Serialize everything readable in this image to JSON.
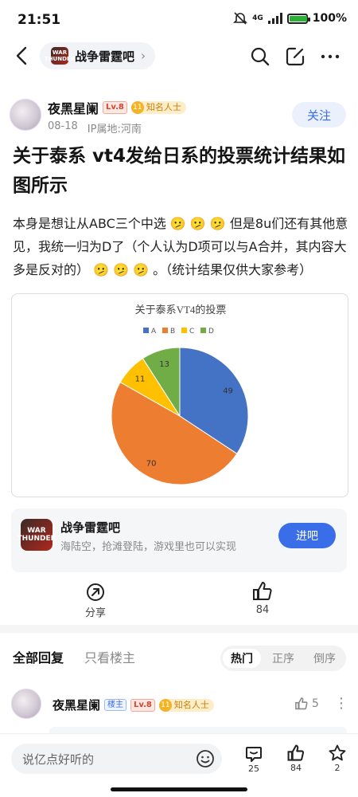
{
  "status": {
    "time": "21:51",
    "network": "4G",
    "battery": "100%",
    "battery_level": 1.0
  },
  "header": {
    "forum_name": "战争雷霆吧",
    "logo_text": "WAR THUNDER"
  },
  "post": {
    "author": "夜黑星阑",
    "level": "Lv.8",
    "badge": "知名人士",
    "badge_num": "11",
    "date": "08-18",
    "ip": "IP属地:河南",
    "follow_label": "关注",
    "title": "关于泰系 vt4发给日系的投票统计结果如图所示",
    "body": "本身是想让从ABC三个中选 🫤 🫤 🫤 但是8u们还有其他意见，我统一归为D了（个人认为D项可以与A合并，其内容大多是反对的） 🫤 🫤 🫤 。（统计结果仅供大家参考）"
  },
  "chart_data": {
    "type": "pie",
    "title": "关于泰系VT4的投票",
    "categories": [
      "A",
      "B",
      "C",
      "D"
    ],
    "values": [
      49,
      70,
      11,
      13
    ],
    "colors": [
      "#4472c4",
      "#ed7d31",
      "#ffc000",
      "#70ad47"
    ],
    "legend": "top"
  },
  "forum_card": {
    "name": "战争雷霆吧",
    "desc": "海陆空，抢滩登陆，游戏里也可以实现",
    "enter_label": "进吧"
  },
  "actions": {
    "share_label": "分享",
    "like_count": "84"
  },
  "replies": {
    "tab_all": "全部回复",
    "tab_op": "只看楼主",
    "sort": [
      "热门",
      "正序",
      "倒序"
    ],
    "first": {
      "author": "夜黑星阑",
      "host_tag": "楼主",
      "level": "Lv.8",
      "badge": "知名人士",
      "badge_num": "11",
      "likes": "5"
    }
  },
  "bottom": {
    "placeholder": "说亿点好听的",
    "comments": "25",
    "likes": "84",
    "favorites": "2"
  }
}
